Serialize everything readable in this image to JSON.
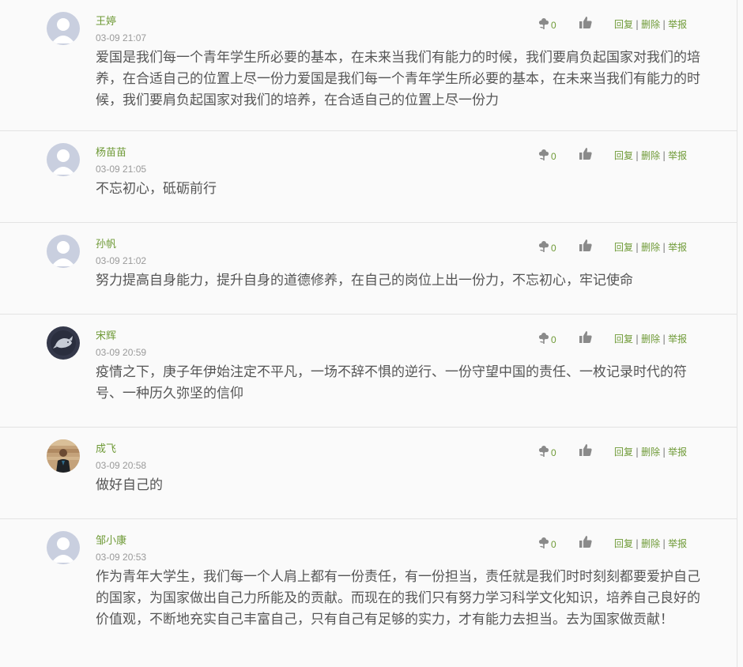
{
  "accent_color": "#6f9a37",
  "comments": [
    {
      "author": "王婷",
      "time": "03-09 21:07",
      "avatar": "default-avatar",
      "text": "爱国是我们每一个青年学生所必要的基本，在未来当我们有能力的时候，我们要肩负起国家对我们的培养，在合适自己的位置上尽一份力爱国是我们每一个青年学生所必要的基本，在未来当我们有能力的时候，我们要肩负起国家对我们的培养，在合适自己的位置上尽一份力",
      "flower_count": "0"
    },
    {
      "author": "杨苗苗",
      "time": "03-09 21:05",
      "avatar": "default-avatar",
      "text": "不忘初心，砥砺前行",
      "flower_count": "0"
    },
    {
      "author": "孙帆",
      "time": "03-09 21:02",
      "avatar": "default-avatar",
      "text": "努力提高自身能力，提升自身的道德修养，在自己的岗位上出一份力，不忘初心，牢记使命",
      "flower_count": "0"
    },
    {
      "author": "宋辉",
      "time": "03-09 20:59",
      "avatar": "whale-avatar",
      "text": "疫情之下，庚子年伊始注定不平凡，一场不辞不惧的逆行、一份守望中国的责任、一枚记录时代的符号、一种历久弥坚的信仰",
      "flower_count": "0"
    },
    {
      "author": "成飞",
      "time": "03-09 20:58",
      "avatar": "photo-avatar",
      "text": "做好自己的",
      "flower_count": "0"
    },
    {
      "author": "邹小康",
      "time": "03-09 20:53",
      "avatar": "default-avatar",
      "text": "作为青年大学生，我们每一个人肩上都有一份责任，有一份担当，责任就是我们时时刻刻都要爱护自己的国家，为国家做出自己力所能及的贡献。而现在的我们只有努力学习科学文化知识，培养自己良好的价值观，不断地充实自己丰富自己，只有自己有足够的实力，才有能力去担当。去为国家做贡献！",
      "flower_count": "0"
    }
  ],
  "actions": {
    "reply": "回复",
    "delete": "删除",
    "report": "举报",
    "separator": "|"
  }
}
